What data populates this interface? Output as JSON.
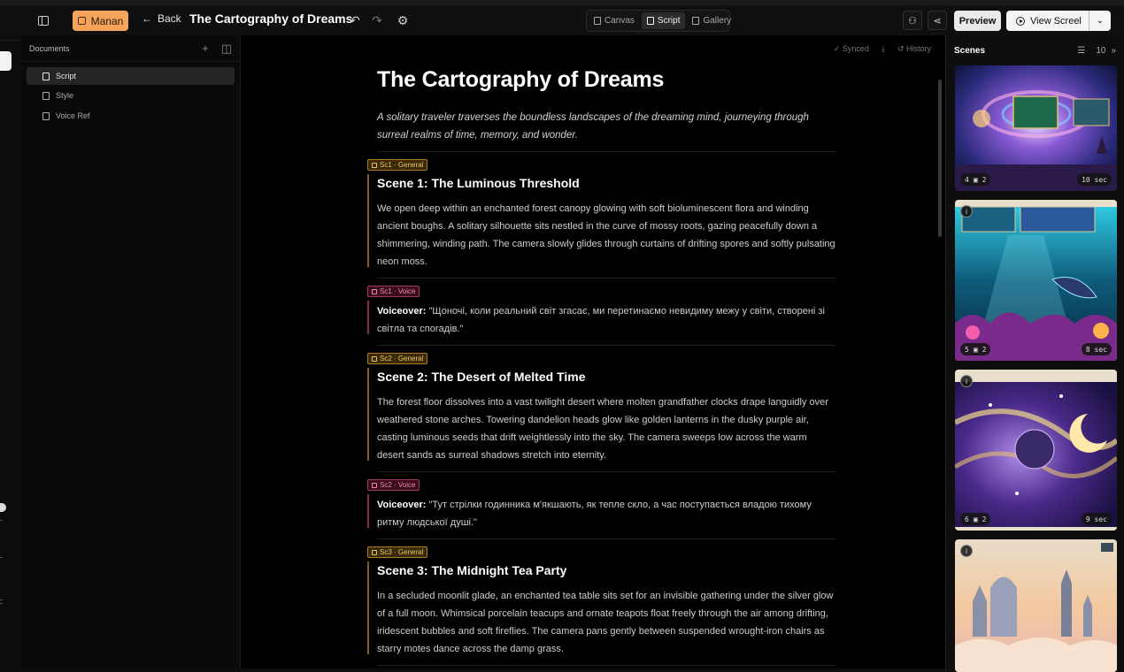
{
  "header": {
    "user_name": "Manan",
    "back_label": "Back",
    "doc_title": "The Cartography of Dreams",
    "tabs": [
      {
        "label": "Canvas",
        "active": false
      },
      {
        "label": "Script",
        "active": true
      },
      {
        "label": "Gallery",
        "active": false
      }
    ],
    "preview_label": "Preview",
    "view_label": "View Screel",
    "accent": "#f6a45c"
  },
  "documents": {
    "title": "Documents",
    "items": [
      {
        "label": "Script",
        "active": true
      },
      {
        "label": "Style",
        "active": false
      },
      {
        "label": "Voice Ref",
        "active": false
      }
    ]
  },
  "editor": {
    "synced_label": "Synced",
    "history_label": "History",
    "title": "The Cartography of Dreams",
    "logline": "A solitary traveler traverses the boundless landscapes of the dreaming mind, journeying through surreal realms of time, memory, and wonder.",
    "blocks": [
      {
        "tag": "Sc1 · General",
        "kind": "general",
        "heading": "Scene 1: The Luminous Threshold",
        "text": "We open deep within an enchanted forest canopy glowing with soft bioluminescent flora and winding ancient boughs. A solitary silhouette sits nestled in the curve of mossy roots, gazing peacefully down a shimmering, winding path. The camera slowly glides through curtains of drifting spores and softly pulsating neon moss."
      },
      {
        "tag": "Sc1 · Voice",
        "kind": "voice",
        "label": "Voiceover:",
        "text": " \"Щоночі, коли реальний світ згасає, ми перетинаємо невидиму межу у світи, створені зі світла та спогадів.\""
      },
      {
        "tag": "Sc2 · General",
        "kind": "general",
        "heading": "Scene 2: The Desert of Melted Time",
        "text": "The forest floor dissolves into a vast twilight desert where molten grandfather clocks drape languidly over weathered stone arches. Towering dandelion heads glow like golden lanterns in the dusky purple air, casting luminous seeds that drift weightlessly into the sky. The camera sweeps low across the warm desert sands as surreal shadows stretch into eternity."
      },
      {
        "tag": "Sc2 · Voice",
        "kind": "voice",
        "label": "Voiceover:",
        "text": " \"Тут стрілки годинника м'якшають, як тепле скло, а час поступається владою тихому ритму людської душі.\""
      },
      {
        "tag": "Sc3 · General",
        "kind": "general",
        "heading": "Scene 3: The Midnight Tea Party",
        "text": "In a secluded moonlit glade, an enchanted tea table sits set for an invisible gathering under the silver glow of a full moon. Whimsical porcelain teacups and ornate teapots float freely through the air among drifting, iridescent bubbles and soft fireflies. The camera pans gently between suspended wrought-iron chairs as starry motes dance across the damp grass."
      }
    ]
  },
  "scenes": {
    "title": "Scenes",
    "count": "10",
    "cards": [
      {
        "index": "4",
        "assets": "2",
        "duration": "10 sec",
        "theme": "galaxy"
      },
      {
        "index": "5",
        "assets": "2",
        "duration": "8 sec",
        "theme": "ocean"
      },
      {
        "index": "6",
        "assets": "2",
        "duration": "9 sec",
        "theme": "moon"
      },
      {
        "index": "",
        "assets": "",
        "duration": "",
        "theme": "castle"
      }
    ]
  }
}
